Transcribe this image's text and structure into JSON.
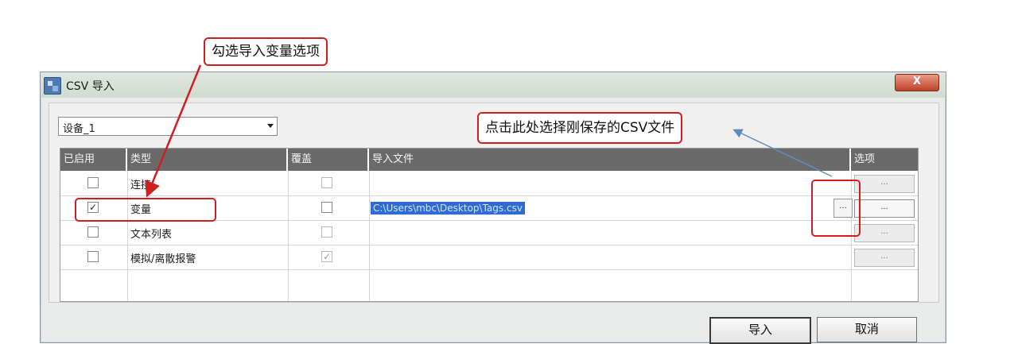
{
  "dialog": {
    "title": "CSV 导入",
    "close_label": "X",
    "device_select_value": "设备_1",
    "columns": [
      "已启用",
      "类型",
      "覆盖",
      "导入文件",
      "选项"
    ],
    "rows": [
      {
        "type": "连接",
        "enabled": false,
        "overwrite": false,
        "overwrite_disabled": true,
        "file": "",
        "option_label": "..."
      },
      {
        "type": "变量",
        "enabled": true,
        "overwrite": false,
        "overwrite_disabled": false,
        "file": "C:\\Users\\mbc\\Desktop\\Tags.csv",
        "option_label": "..."
      },
      {
        "type": "文本列表",
        "enabled": false,
        "overwrite": false,
        "overwrite_disabled": true,
        "file": "",
        "option_label": "..."
      },
      {
        "type": "模拟/离散报警",
        "enabled": false,
        "overwrite": true,
        "overwrite_disabled": true,
        "file": "",
        "option_label": "..."
      }
    ],
    "browse_label": "...",
    "import_button": "导入",
    "cancel_button": "取消"
  },
  "annotations": {
    "check_import_variable": "勾选导入变量选项",
    "click_here_select_csv": "点击此处选择刚保存的CSV文件"
  },
  "colors": {
    "annotation_red": "#d01f1f",
    "header_gray": "#6a6a6a",
    "selection_blue": "#2f6bd3"
  }
}
